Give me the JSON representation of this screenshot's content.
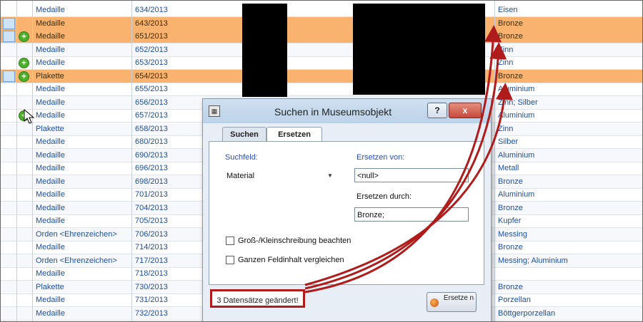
{
  "rows": [
    {
      "type": "Medaille",
      "number": "634/2013",
      "material": "Eisen",
      "selected": false,
      "plus": false
    },
    {
      "type": "Medaille",
      "number": "643/2013",
      "material": "Bronze",
      "selected": true,
      "plus": false
    },
    {
      "type": "Medaille",
      "number": "651/2013",
      "material": "Bronze",
      "selected": true,
      "plus": true
    },
    {
      "type": "Medaille",
      "number": "652/2013",
      "material": "Zinn",
      "selected": false,
      "plus": false
    },
    {
      "type": "Medaille",
      "number": "653/2013",
      "material": "Zinn",
      "selected": false,
      "plus": true
    },
    {
      "type": "Plakette",
      "number": "654/2013",
      "material": "Bronze",
      "selected": true,
      "plus": true
    },
    {
      "type": "Medaille",
      "number": "655/2013",
      "material": "Aluminium",
      "selected": false,
      "plus": false
    },
    {
      "type": "Medaille",
      "number": "656/2013",
      "material": "Zinn; Silber",
      "selected": false,
      "plus": false
    },
    {
      "type": "Medaille",
      "number": "657/2013",
      "material": "Aluminium",
      "selected": false,
      "plus": true
    },
    {
      "type": "Plakette",
      "number": "658/2013",
      "material": "Zinn",
      "selected": false,
      "plus": false
    },
    {
      "type": "Medaille",
      "number": "680/2013",
      "material": "Silber",
      "selected": false,
      "plus": false
    },
    {
      "type": "Medaille",
      "number": "690/2013",
      "material": "Aluminium",
      "selected": false,
      "plus": false
    },
    {
      "type": "Medaille",
      "number": "696/2013",
      "material": "Metall",
      "selected": false,
      "plus": false
    },
    {
      "type": "Medaille",
      "number": "698/2013",
      "material": "Bronze",
      "selected": false,
      "plus": false
    },
    {
      "type": "Medaille",
      "number": "701/2013",
      "material": "Aluminium",
      "selected": false,
      "plus": false
    },
    {
      "type": "Medaille",
      "number": "704/2013",
      "material": "Bronze",
      "selected": false,
      "plus": false
    },
    {
      "type": "Medaille",
      "number": "705/2013",
      "material": "Kupfer",
      "selected": false,
      "plus": false
    },
    {
      "type": "Orden <Ehrenzeichen>",
      "number": "706/2013",
      "material": "Messing",
      "selected": false,
      "plus": false
    },
    {
      "type": "Medaille",
      "number": "714/2013",
      "material": "Bronze",
      "selected": false,
      "plus": false
    },
    {
      "type": "Orden <Ehrenzeichen>",
      "number": "717/2013",
      "material": "Messing; Aluminium",
      "selected": false,
      "plus": false
    },
    {
      "type": "Medaille",
      "number": "718/2013",
      "material": "",
      "selected": false,
      "plus": false
    },
    {
      "type": "Plakette",
      "number": "730/2013",
      "material": "Bronze",
      "selected": false,
      "plus": false
    },
    {
      "type": "Medaille",
      "number": "731/2013",
      "material": "Porzellan",
      "selected": false,
      "plus": false
    },
    {
      "type": "Medaille",
      "number": "732/2013",
      "material": "Böttgerporzellan",
      "selected": false,
      "plus": false
    }
  ],
  "dialog": {
    "title": "Suchen in Museumsobjekt",
    "help_label": "?",
    "close_label": "x",
    "tabs": [
      "Suchen",
      "Ersetzen"
    ],
    "active_tab": "Ersetzen",
    "suchfeld_label": "Suchfeld:",
    "suchfeld_value": "Material",
    "ersetzen_von_label": "Ersetzen von:",
    "ersetzen_von_value": "<null>",
    "ersetzen_durch_label": "Ersetzen durch:",
    "ersetzen_durch_value": "Bronze;",
    "checkbox1_label": "Groß-/Kleinschreibung beachten",
    "checkbox2_label": "Ganzen Feldinhalt vergleichen",
    "status": "3 Datensätze geändert!",
    "replace_button_label": "Ersetze n"
  },
  "colors": {
    "selected_row": "#f9b36e",
    "annotation": "#b01c1c",
    "link_text": "#1f4fa0"
  }
}
